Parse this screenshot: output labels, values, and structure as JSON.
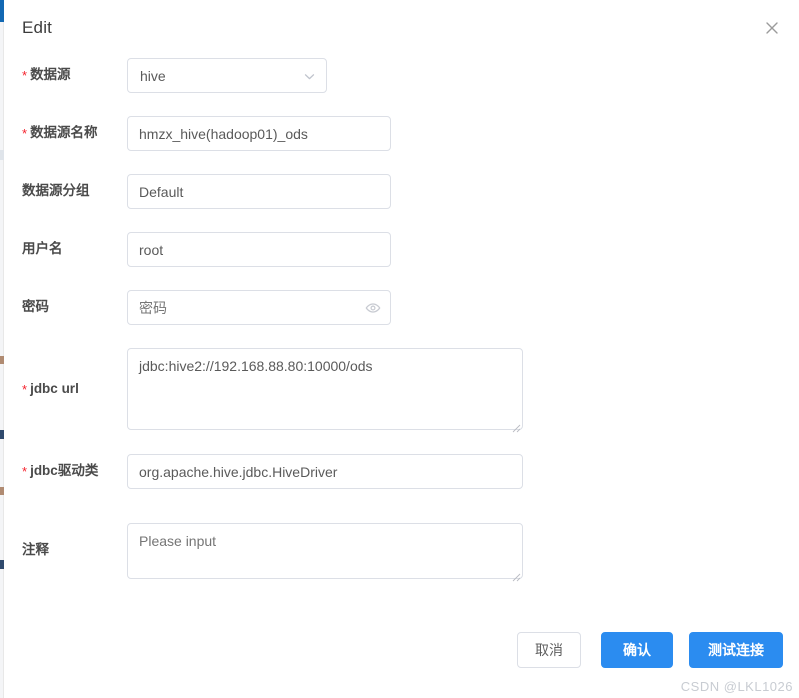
{
  "dialog": {
    "title": "Edit",
    "close_icon": "close-icon"
  },
  "form": {
    "fields": [
      {
        "label": "数据源",
        "required": true,
        "type": "select",
        "value": "hive",
        "icon": "chevron-down-icon"
      },
      {
        "label": "数据源名称",
        "required": true,
        "type": "input",
        "value": "hmzx_hive(hadoop01)_ods",
        "placeholder": ""
      },
      {
        "label": "数据源分组",
        "required": false,
        "type": "input",
        "value": "Default",
        "placeholder": ""
      },
      {
        "label": "用户名",
        "required": false,
        "type": "input",
        "value": "root",
        "placeholder": ""
      },
      {
        "label": "密码",
        "required": false,
        "type": "password",
        "value": "",
        "placeholder": "密码",
        "icon": "eye-icon"
      },
      {
        "label": "jdbc url",
        "required": true,
        "type": "textarea",
        "value": "jdbc:hive2://192.168.88.80:10000/ods",
        "placeholder": ""
      },
      {
        "label": "jdbc驱动类",
        "required": true,
        "type": "input",
        "value": "org.apache.hive.jdbc.HiveDriver",
        "placeholder": ""
      },
      {
        "label": "注释",
        "required": false,
        "type": "textarea",
        "value": "",
        "placeholder": "Please input"
      }
    ]
  },
  "footer": {
    "cancel_label": "取消",
    "confirm_label": "确认",
    "test_label": "测试连接"
  },
  "watermark": {
    "text": "CSDN @LKL1026"
  },
  "colors": {
    "primary": "#2b8cf0",
    "required_star": "#f5222d",
    "border": "#dcdfe6",
    "text": "#4a4a4a",
    "placeholder": "#c3c6cd",
    "watermark": "#c8ccd2"
  }
}
